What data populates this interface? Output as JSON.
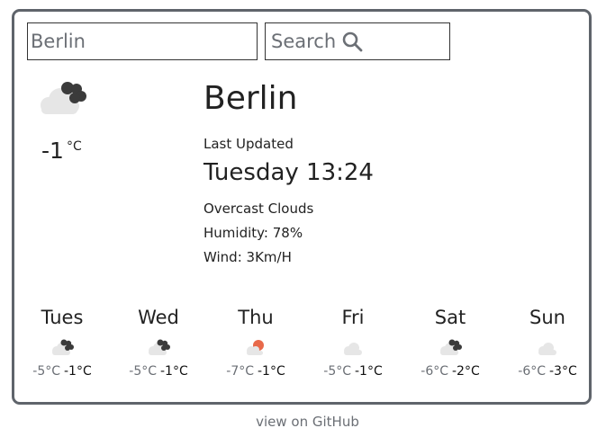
{
  "search": {
    "value": "Berlin",
    "button_label": "Search"
  },
  "current": {
    "city": "Berlin",
    "temperature": "-1",
    "unit": "°C",
    "updated_label": "Last Updated",
    "updated_time": "Tuesday 13:24",
    "description": "Overcast Clouds",
    "humidity": "Humidity: 78%",
    "wind": "Wind: 3Km/H",
    "icon": "broken-clouds-icon"
  },
  "forecast": [
    {
      "day": "Tues",
      "min": "-5°C",
      "max": "-1°C",
      "icon": "broken-clouds-icon"
    },
    {
      "day": "Wed",
      "min": "-5°C",
      "max": "-1°C",
      "icon": "broken-clouds-icon"
    },
    {
      "day": "Thu",
      "min": "-7°C",
      "max": "-1°C",
      "icon": "few-clouds-sun-icon"
    },
    {
      "day": "Fri",
      "min": "-5°C",
      "max": "-1°C",
      "icon": "cloud-icon"
    },
    {
      "day": "Sat",
      "min": "-6°C",
      "max": "-2°C",
      "icon": "broken-clouds-icon"
    },
    {
      "day": "Sun",
      "min": "-6°C",
      "max": "-3°C",
      "icon": "cloud-icon"
    }
  ],
  "footer": {
    "link_label": "view on GitHub"
  },
  "colors": {
    "border": "#5f646b",
    "muted_text": "#6b6f75",
    "sun": "#e8694a",
    "light_cloud": "#e6e6e6",
    "dark_cloud": "#3b3b3b"
  }
}
